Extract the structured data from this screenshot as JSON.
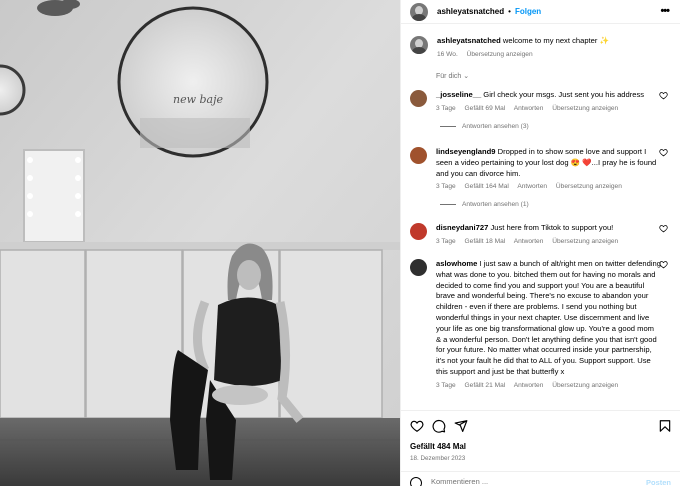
{
  "post": {
    "username": "ashleyatsnatched",
    "follow_label": "Folgen",
    "more_icon": "more-horizontal-icon",
    "caption": {
      "username": "ashleyatsnatched",
      "text": "welcome to my next chapter ✨",
      "age": "16 Wo.",
      "translate": "Übersetzung anzeigen"
    },
    "for_you": "Für dich"
  },
  "photo": {
    "mirror_text": "new baje"
  },
  "comments": [
    {
      "username": "_josseline__",
      "text": "Girl check your msgs. Just sent you his address",
      "age": "3 Tage",
      "likes": "Gefällt 69 Mal",
      "reply": "Antworten",
      "translate": "Übersetzung anzeigen",
      "replies": "Antworten ansehen (3)",
      "avatar_color": "#8a5a3c"
    },
    {
      "username": "lindseyengland9",
      "text": "Dropped in to show some love and support I seen a video pertaining to your lost dog 😍 ❤️...I pray he is found and you can divorce him.",
      "age": "3 Tage",
      "likes": "Gefällt 164 Mal",
      "reply": "Antworten",
      "translate": "Übersetzung anzeigen",
      "replies": "Antworten ansehen (1)",
      "avatar_color": "#a0522d"
    },
    {
      "username": "disneydani727",
      "text": "Just here from Tiktok to support you!",
      "age": "3 Tage",
      "likes": "Gefällt 18 Mal",
      "reply": "Antworten",
      "translate": "Übersetzung anzeigen",
      "avatar_color": "#c0392b"
    },
    {
      "username": "aslowhome",
      "text": "I just saw a bunch of alt/right men on twitter defending what was done to you. bitched them out for having no morals and decided to come find you and support you! You are a beautiful brave and wonderful being. There's no excuse to abandon your children - even if there are problems. I send you nothing but wonderful things in your next chapter. Use discernment and live your life as one big transformational glow up. You're a good mom & a wonderful person. Don't let anything define you that isn't good for your future. No matter what occurred inside your partnership, it's not your fault he did that to ALL of you. Support support. Use this support and just be that butterfly x",
      "age": "3 Tage",
      "likes": "Gefällt 21 Mal",
      "reply": "Antworten",
      "translate": "Übersetzung anzeigen",
      "avatar_color": "#2f2f2f"
    }
  ],
  "actions": {
    "like_icon": "heart-icon",
    "comment_icon": "comment-icon",
    "share_icon": "share-icon",
    "save_icon": "bookmark-icon"
  },
  "likes": "Gefällt 484 Mal",
  "date": "18. Dezember 2023",
  "composer": {
    "placeholder": "Kommentieren ...",
    "post_label": "Posten"
  },
  "colors": {
    "link_blue": "#0095f6",
    "muted": "#737373",
    "post_disabled": "#b2dffc"
  }
}
